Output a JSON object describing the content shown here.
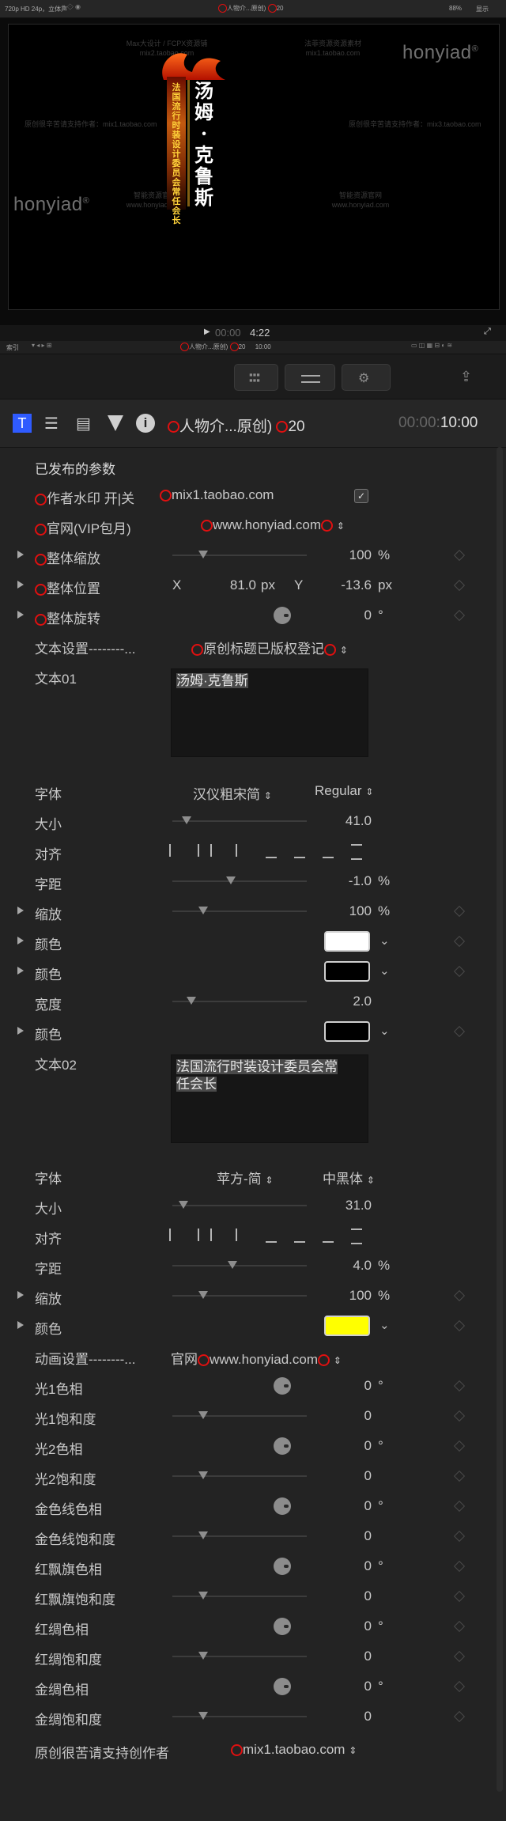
{
  "topbar": {
    "format": "720p HD 24p，立体声",
    "clip": "人物介...原创)",
    "count": "20",
    "zoom": "88%",
    "view": "显示"
  },
  "viewer": {
    "watermarks": [
      {
        "text": "Max大设计 / FCPX资源铺",
        "sub": "mix2.taobao.com"
      },
      {
        "text": "法菲资源资源素材",
        "sub": "mix1.taobao.com"
      },
      {
        "text": "原创很辛苦请支持作者：mix1.taobao.com",
        "sub": ""
      },
      {
        "text": "原创很辛苦请支持作者：mix3.taobao.com",
        "sub": ""
      },
      {
        "text": "智能资源官网",
        "sub": "www.honyiad.com"
      },
      {
        "text": "智能资源官网",
        "sub": "www.honyiad.com"
      }
    ],
    "brand": "honyiad",
    "reg": "®",
    "title_name": "汤姆·克鲁斯",
    "title_role": "法国流行时装设计委员会常任会长"
  },
  "playbar": {
    "timecode_dim": "00:00",
    "timecode": "4:22"
  },
  "timeline_bar": {
    "index": "索引",
    "clip": "人物介...原创)",
    "count": "20",
    "duration": "10:00"
  },
  "inspector": {
    "header": {
      "clip": "人物介...原创)",
      "count": "20",
      "time_dim": "00:00:",
      "time": "10:00"
    },
    "published": "已发布的参数",
    "rows": {
      "watermark_label": "作者水印 开|关",
      "watermark_value": "mix1.taobao.com",
      "site_label": "官网(VIP包月)",
      "site_value": "www.honyiad.com",
      "scale_label": "整体缩放",
      "scale_value": "100",
      "scale_unit": "%",
      "pos_label": "整体位置",
      "pos_x": "X",
      "pos_x_val": "81.0",
      "pos_x_unit": "px",
      "pos_y": "Y",
      "pos_y_val": "-13.6",
      "pos_y_unit": "px",
      "rot_label": "整体旋转",
      "rot_value": "0",
      "rot_unit": "°",
      "text_settings": "文本设置--------...",
      "text_settings_value": "原创标题已版权登记",
      "text01": "文本01",
      "text01_value": "汤姆·克鲁斯"
    },
    "text01_props": {
      "font_label": "字体",
      "font": "汉仪粗宋简",
      "style": "Regular",
      "size_label": "大小",
      "size": "41.0",
      "align_label": "对齐",
      "tracking_label": "字距",
      "tracking": "-1.0",
      "tracking_unit": "%",
      "scale_label": "缩放",
      "scale": "100",
      "scale_unit": "%",
      "color1_label": "颜色",
      "color2_label": "颜色",
      "width_label": "宽度",
      "width": "2.0",
      "color3_label": "颜色",
      "color1": "#ffffff",
      "color2": "#000000",
      "color3": "#000000"
    },
    "text02_props": {
      "label": "文本02",
      "value_line1": "法国流行时装设计委员会常",
      "value_line2": "任会长",
      "font_label": "字体",
      "font": "苹方-简",
      "style": "中黑体",
      "size_label": "大小",
      "size": "31.0",
      "align_label": "对齐",
      "tracking_label": "字距",
      "tracking": "4.0",
      "tracking_unit": "%",
      "scale_label": "缩放",
      "scale": "100",
      "scale_unit": "%",
      "color_label": "颜色",
      "color": "#ffff00"
    },
    "anim": {
      "label": "动画设置--------...",
      "prefix": "官网",
      "value": "www.honyiad.com",
      "items": [
        {
          "label": "光1色相",
          "value": "0",
          "unit": "°",
          "kind": "knob"
        },
        {
          "label": "光1饱和度",
          "value": "0",
          "unit": "",
          "kind": "slider"
        },
        {
          "label": "光2色相",
          "value": "0",
          "unit": "°",
          "kind": "knob"
        },
        {
          "label": "光2饱和度",
          "value": "0",
          "unit": "",
          "kind": "slider"
        },
        {
          "label": "金色线色相",
          "value": "0",
          "unit": "°",
          "kind": "knob"
        },
        {
          "label": "金色线饱和度",
          "value": "0",
          "unit": "",
          "kind": "slider"
        },
        {
          "label": "红飘旗色相",
          "value": "0",
          "unit": "°",
          "kind": "knob"
        },
        {
          "label": "红飘旗饱和度",
          "value": "0",
          "unit": "",
          "kind": "slider"
        },
        {
          "label": "红绸色相",
          "value": "0",
          "unit": "°",
          "kind": "knob"
        },
        {
          "label": "红绸饱和度",
          "value": "0",
          "unit": "",
          "kind": "slider"
        },
        {
          "label": "金绸色相",
          "value": "0",
          "unit": "°",
          "kind": "knob"
        },
        {
          "label": "金绸饱和度",
          "value": "0",
          "unit": "",
          "kind": "slider"
        }
      ],
      "footer_label": "原创很苦请支持创作者",
      "footer_value": "mix1.taobao.com"
    }
  }
}
